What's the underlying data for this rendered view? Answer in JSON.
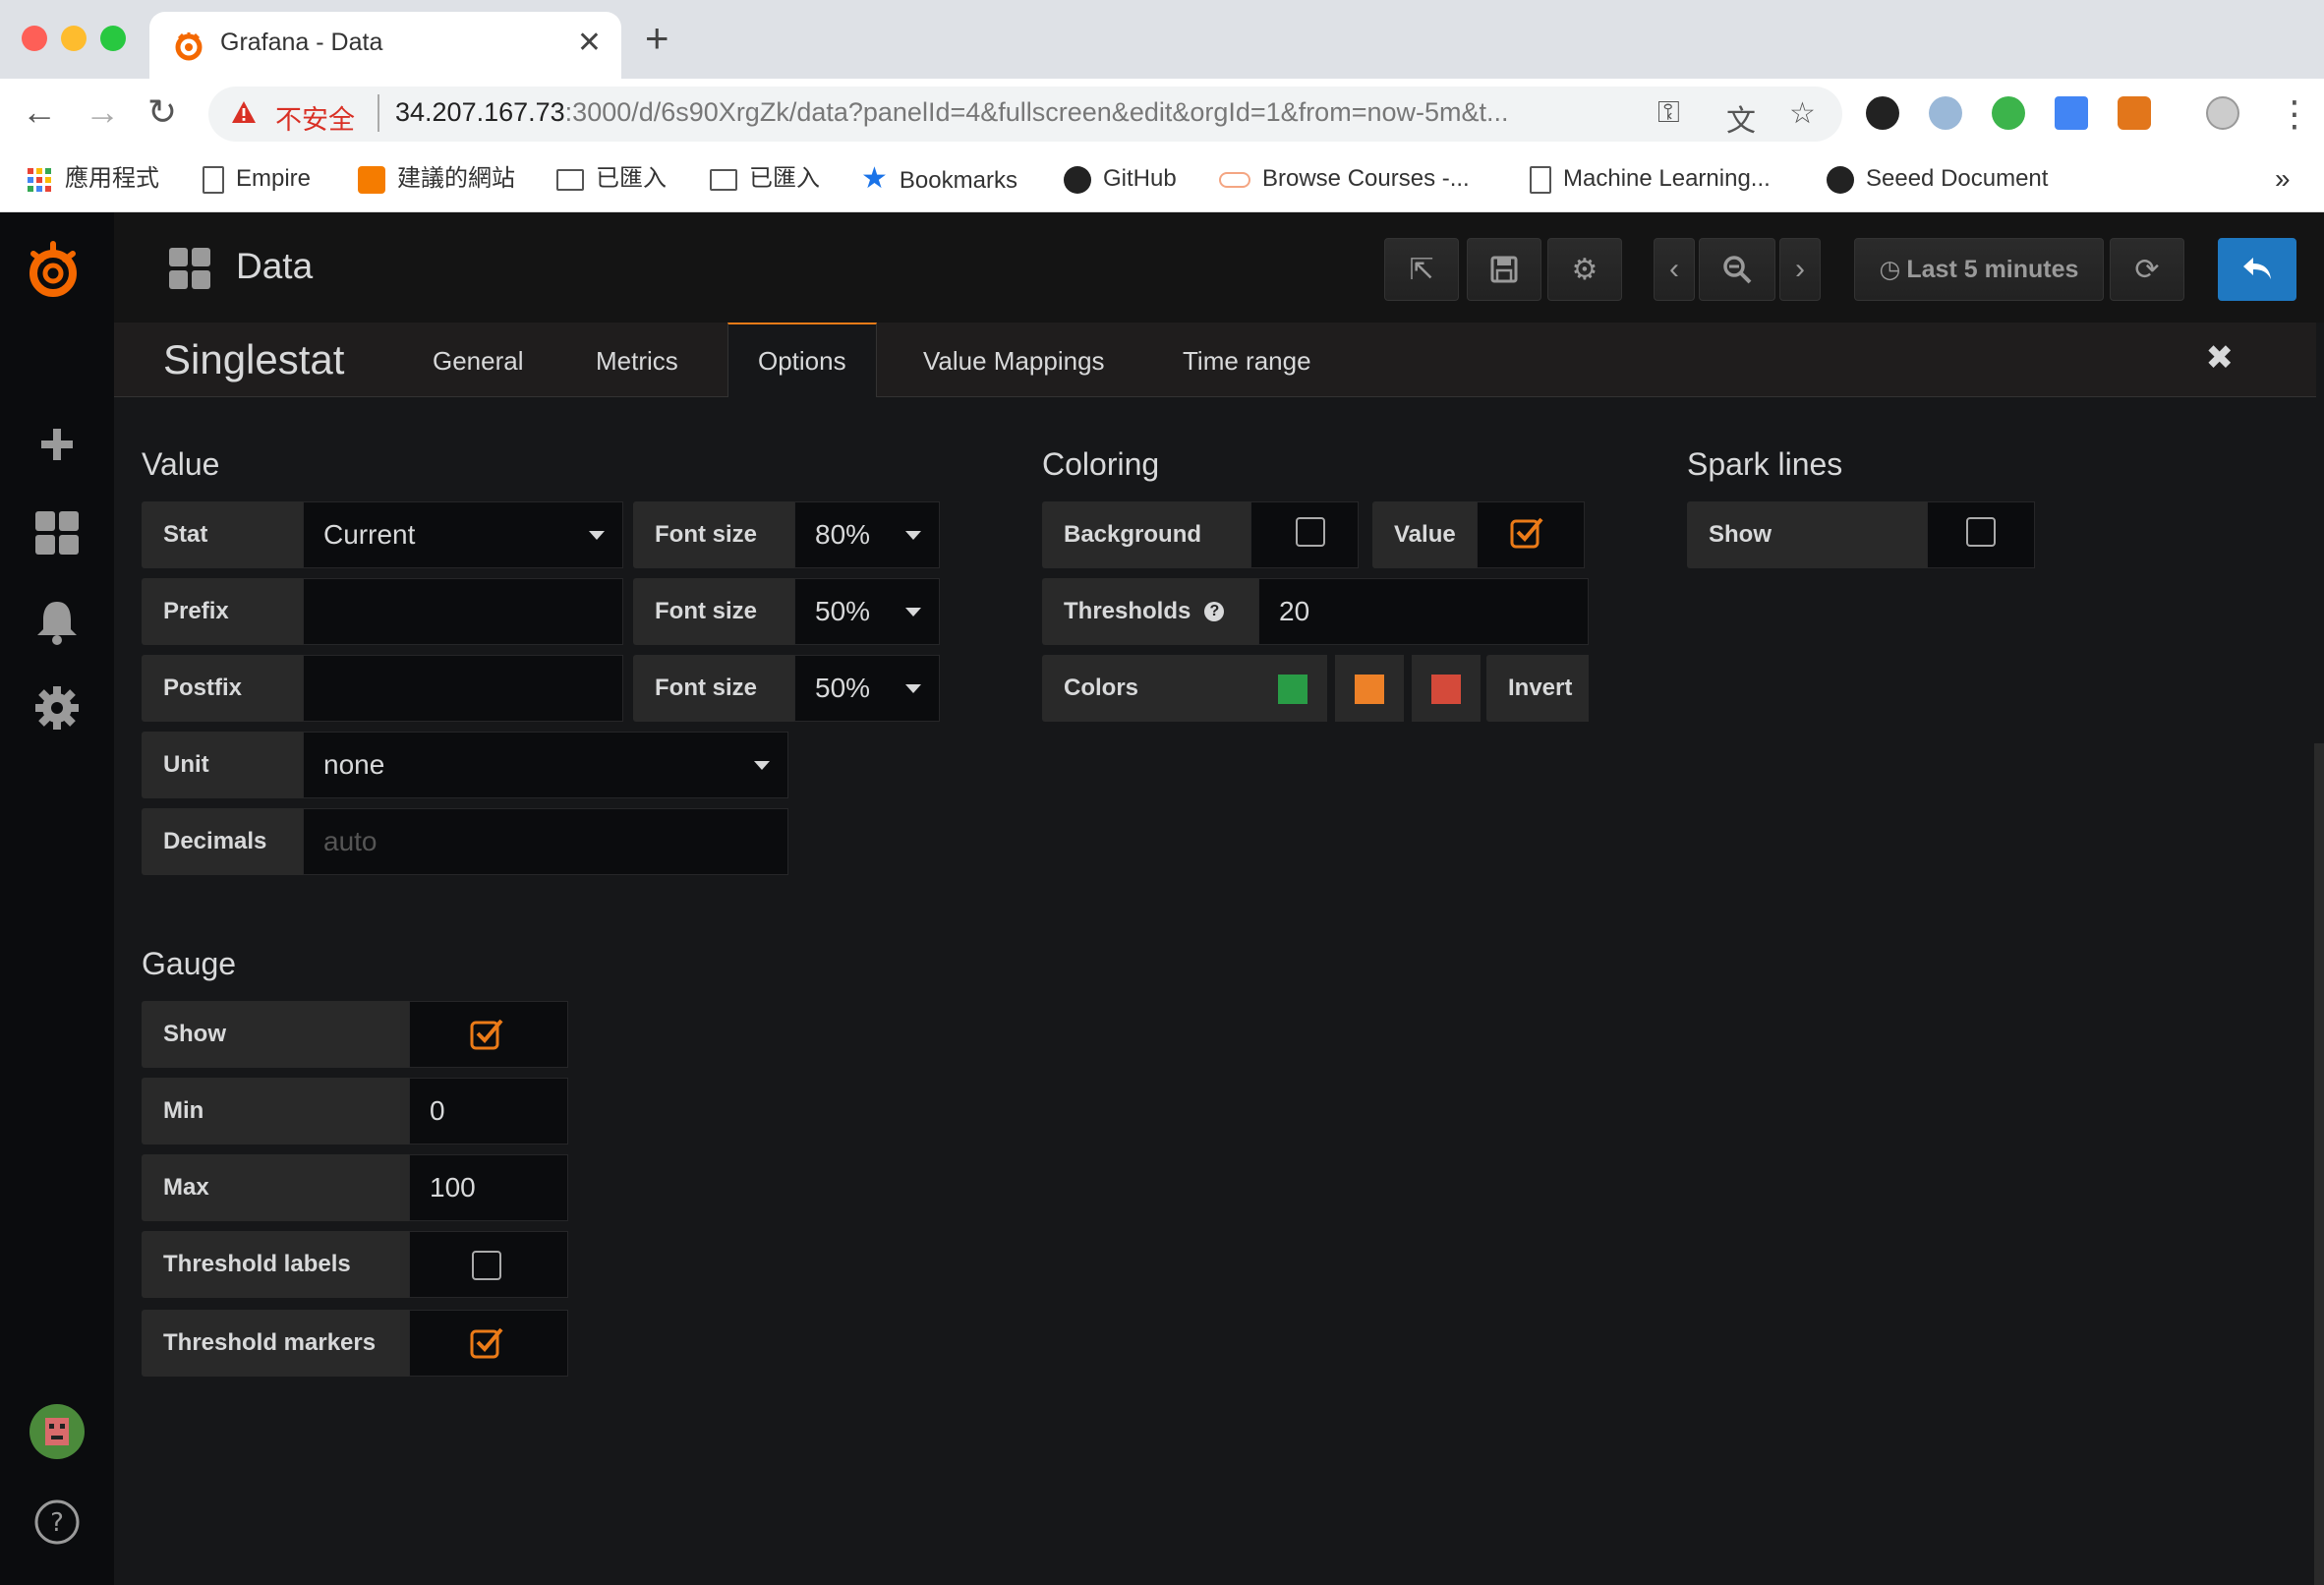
{
  "browser": {
    "tab_title": "Grafana - Data",
    "insecure_label": "不安全",
    "url_host": "34.207.167.73",
    "url_rest": ":3000/d/6s90XrgZk/data?panelId=4&fullscreen&edit&orgId=1&from=now-5m&t...",
    "bookmarks": [
      {
        "label": "應用程式",
        "icon": "apps-grid-icon"
      },
      {
        "label": "Empire",
        "icon": "page-icon"
      },
      {
        "label": "建議的網站",
        "icon": "bulb-icon"
      },
      {
        "label": "已匯入",
        "icon": "folder-icon"
      },
      {
        "label": "已匯入",
        "icon": "folder-icon"
      },
      {
        "label": "Bookmarks",
        "icon": "star-icon"
      },
      {
        "label": "GitHub",
        "icon": "github-icon"
      },
      {
        "label": "Browse Courses -...",
        "icon": "cloud-icon"
      },
      {
        "label": "Machine Learning...",
        "icon": "page-icon"
      },
      {
        "label": "Seeed Document",
        "icon": "github-icon"
      }
    ],
    "more_bookmarks": "»"
  },
  "navbar": {
    "dashboard_title": "Data",
    "time_range_label": "Last 5 minutes"
  },
  "editor": {
    "panel_type": "Singlestat",
    "tabs": [
      "General",
      "Metrics",
      "Options",
      "Value Mappings",
      "Time range"
    ],
    "active_tab": "Options"
  },
  "value": {
    "title": "Value",
    "stat_label": "Stat",
    "stat_value": "Current",
    "font_size_label": "Font size",
    "stat_font_size": "80%",
    "prefix_label": "Prefix",
    "prefix_value": "",
    "prefix_font_size": "50%",
    "postfix_label": "Postfix",
    "postfix_value": "",
    "postfix_font_size": "50%",
    "unit_label": "Unit",
    "unit_value": "none",
    "decimals_label": "Decimals",
    "decimals_placeholder": "auto"
  },
  "coloring": {
    "title": "Coloring",
    "background_label": "Background",
    "background_checked": false,
    "value_label": "Value",
    "value_checked": true,
    "thresholds_label": "Thresholds",
    "thresholds_value": "20",
    "colors_label": "Colors",
    "colors": [
      "#299c46",
      "#ed8128",
      "#d44a3a"
    ],
    "invert_label": "Invert"
  },
  "sparklines": {
    "title": "Spark lines",
    "show_label": "Show",
    "show_checked": false
  },
  "gauge": {
    "title": "Gauge",
    "show_label": "Show",
    "show_checked": true,
    "min_label": "Min",
    "min_value": "0",
    "max_label": "Max",
    "max_value": "100",
    "threshold_labels_label": "Threshold labels",
    "threshold_labels_checked": false,
    "threshold_markers_label": "Threshold markers",
    "threshold_markers_checked": true
  },
  "colors": {
    "accent": "#eb7b18",
    "primary_button": "#1f78c1",
    "panel_bg": "#161719"
  }
}
